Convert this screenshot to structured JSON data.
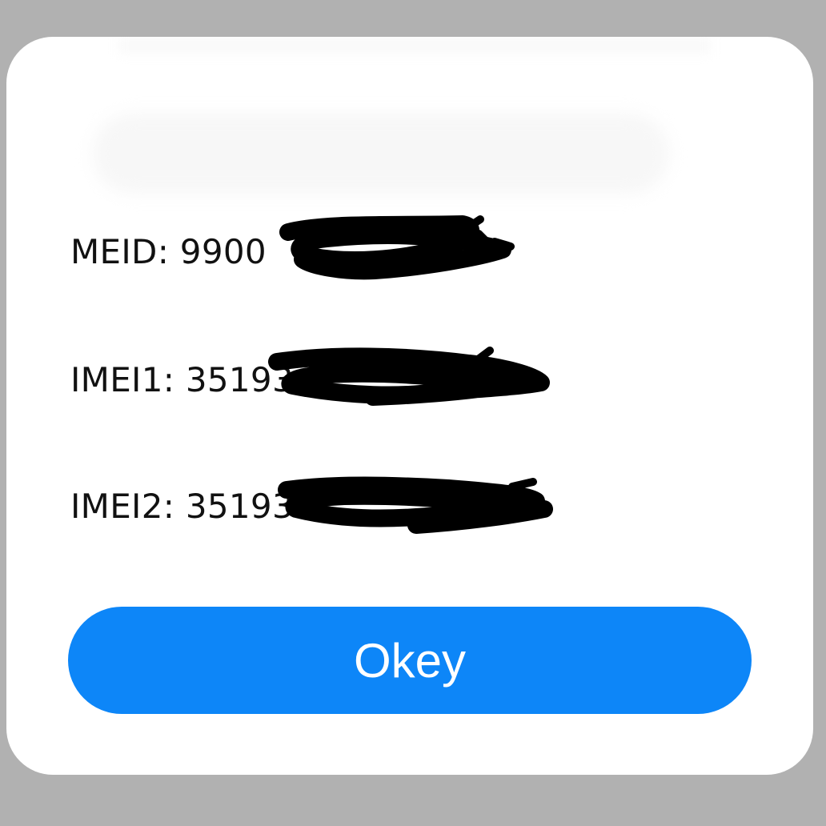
{
  "dialog": {
    "lines": [
      {
        "label": "MEID: 9900"
      },
      {
        "label": "IMEI1: 35193"
      },
      {
        "label": "IMEI2: 35193"
      }
    ],
    "ok_label": "Okey"
  },
  "colors": {
    "backdrop": "#b1b1b1",
    "dialog": "#ffffff",
    "button": "#0d86f8",
    "button_text": "#ffffff",
    "text": "#111111",
    "redaction": "#000000"
  }
}
